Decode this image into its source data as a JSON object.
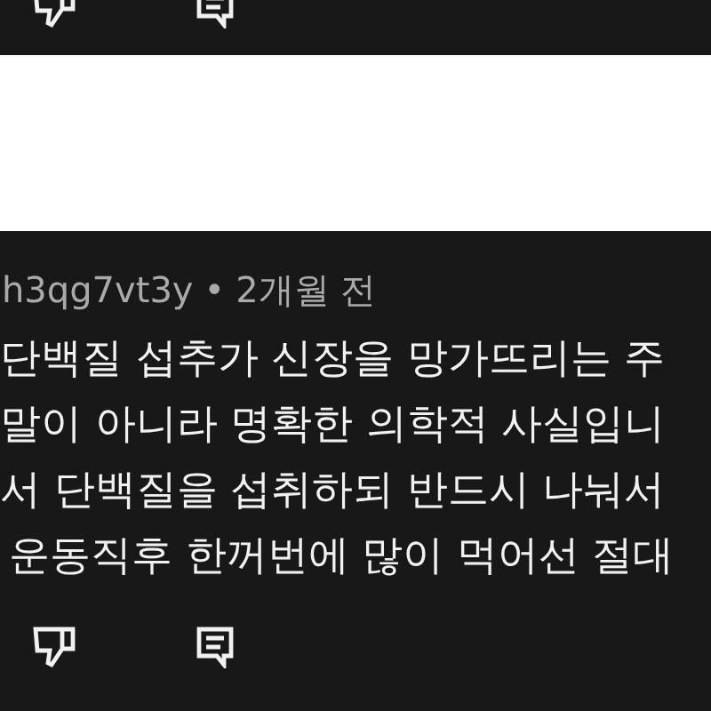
{
  "comment": {
    "author": "h3qg7vt3y",
    "separator": "•",
    "time": "2개월 전",
    "lines": [
      "단백질 섭추가 신장을 망가뜨리는 주",
      "말이 아니라 명확한 의학적 사실입니",
      "서 단백질을 섭취하되 반드시 나눠서",
      "운동직후 한꺼번에 많이 먹어선 절대"
    ]
  }
}
